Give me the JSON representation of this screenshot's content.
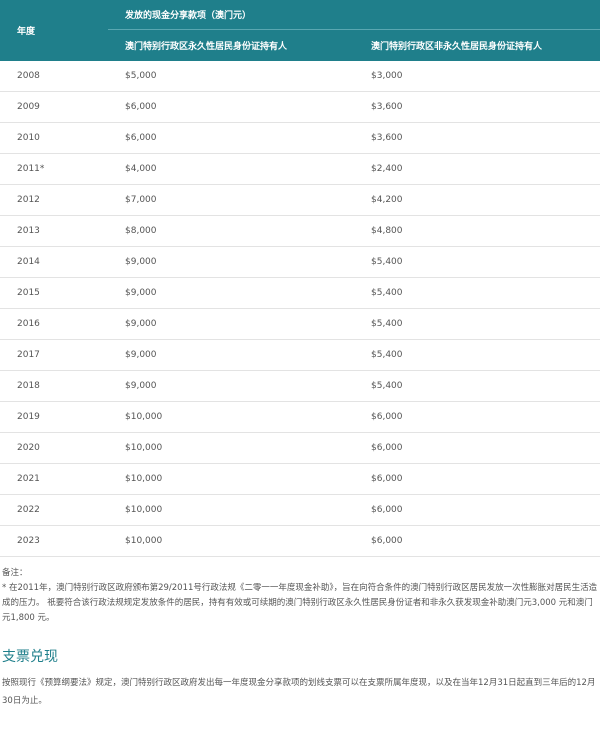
{
  "table": {
    "year_header": "年度",
    "cash_header": "发放的现金分享款项（澳门元）",
    "col_permanent": "澳门特别行政区永久性居民身份证持有人",
    "col_nonpermanent": "澳门特别行政区非永久性居民身份证持有人",
    "rows": [
      {
        "year": "2008",
        "permanent": "$5,000",
        "nonpermanent": "$3,000"
      },
      {
        "year": "2009",
        "permanent": "$6,000",
        "nonpermanent": "$3,600"
      },
      {
        "year": "2010",
        "permanent": "$6,000",
        "nonpermanent": "$3,600"
      },
      {
        "year": "2011*",
        "permanent": "$4,000",
        "nonpermanent": "$2,400"
      },
      {
        "year": "2012",
        "permanent": "$7,000",
        "nonpermanent": "$4,200"
      },
      {
        "year": "2013",
        "permanent": "$8,000",
        "nonpermanent": "$4,800"
      },
      {
        "year": "2014",
        "permanent": "$9,000",
        "nonpermanent": "$5,400"
      },
      {
        "year": "2015",
        "permanent": "$9,000",
        "nonpermanent": "$5,400"
      },
      {
        "year": "2016",
        "permanent": "$9,000",
        "nonpermanent": "$5,400"
      },
      {
        "year": "2017",
        "permanent": "$9,000",
        "nonpermanent": "$5,400"
      },
      {
        "year": "2018",
        "permanent": "$9,000",
        "nonpermanent": "$5,400"
      },
      {
        "year": "2019",
        "permanent": "$10,000",
        "nonpermanent": "$6,000"
      },
      {
        "year": "2020",
        "permanent": "$10,000",
        "nonpermanent": "$6,000"
      },
      {
        "year": "2021",
        "permanent": "$10,000",
        "nonpermanent": "$6,000"
      },
      {
        "year": "2022",
        "permanent": "$10,000",
        "nonpermanent": "$6,000"
      },
      {
        "year": "2023",
        "permanent": "$10,000",
        "nonpermanent": "$6,000"
      }
    ]
  },
  "notes": {
    "title": "备注：",
    "text": "* 在2011年，澳门特别行政区政府颁布第29/2011号行政法规《二零一一年度现金补助》，旨在向符合条件的澳门特别行政区居民发放一次性膨胀对居民生活造成的压力。 祇要符合该行政法规规定发放条件的居民，持有有效或可续期的澳门特别行政区永久性居民身份证者和非永久获发现金补助澳门元3,000 元和澳门元1,800 元。"
  },
  "section": {
    "title": "支票兑现",
    "text": "按照现行《预算纲要法》规定，澳门特别行政区政府发出每一年度现金分享款项的划线支票可以在支票所属年度现，以及在当年12月31日起直到三年后的12月30日为止。"
  },
  "colors": {
    "header_bg": "#1f7f8b",
    "header_text": "#ffffff",
    "section_title": "#1f7f8b"
  }
}
